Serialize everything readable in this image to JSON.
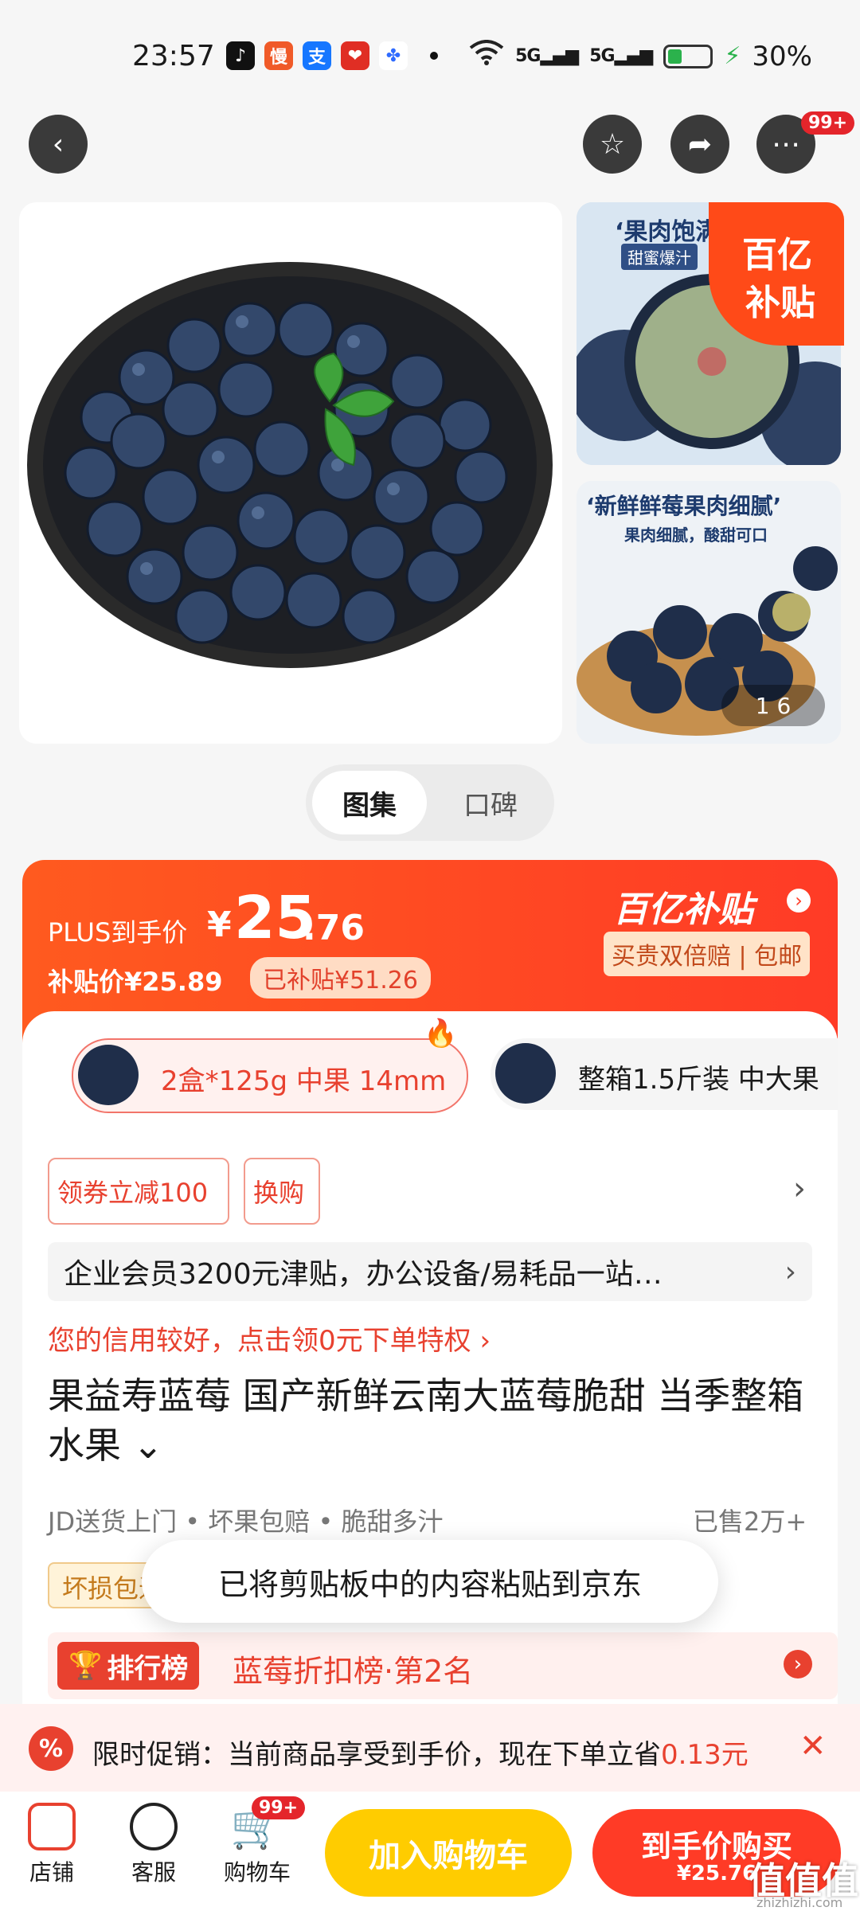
{
  "status_bar": {
    "time": "23:57",
    "battery": "30%",
    "apps": [
      {
        "icon": "douyin-icon",
        "glyph": "♪",
        "color": "#111111"
      },
      {
        "icon": "mantou-icon",
        "glyph": "慢",
        "color": "#f05a28"
      },
      {
        "icon": "alipay-icon",
        "glyph": "支",
        "color": "#1677ff"
      },
      {
        "icon": "pinduoduo-icon",
        "glyph": "❤",
        "color": "#e02e24"
      },
      {
        "icon": "baidu-icon",
        "glyph": "🐾",
        "color": "#ffffff"
      }
    ],
    "signal_1": "5G",
    "signal_2": "5G"
  },
  "nav": {
    "more_badge": "99+"
  },
  "gallery": {
    "thumb1_caption": "‘果肉饱满",
    "thumb1_sub": "甜蜜爆汁",
    "thumb2_caption": "‘新鲜鲜莓果肉细腻’",
    "thumb2_sub": "果肉细腻，酸甜可口",
    "subsidy_badge_top": "百亿",
    "subsidy_badge_bottom": "补贴",
    "page_indicator": "1   6"
  },
  "tabs": {
    "active": "图集",
    "inactive": "口碑"
  },
  "price": {
    "plus_label": "PLUS到手价",
    "currency": "¥",
    "main_int": "25",
    "main_dec": ".76",
    "subsidy_price": "补贴价¥25.89",
    "already_subsidized": "已补贴¥51.26",
    "brand": "百亿补贴",
    "brand_tags": "买贵双倍赔 | 包邮"
  },
  "specs": [
    {
      "label": "2盒*125g 中果 14mm",
      "selected": true
    },
    {
      "label": "整箱1.5斤装 中大果",
      "selected": false
    }
  ],
  "coupons": {
    "coupon": "领券立减100",
    "exchange": "换购"
  },
  "enterprise": "企业会员3200元津贴，办公设备/易耗品一站…",
  "credit": "您的信用较好，点击领0元下单特权 ›",
  "title": "果益寿蓝莓 国产新鲜云南大蓝莓脆甜 当季整箱水果 ⌄",
  "services": "JD送货上门 • 坏果包赔 • 脆甜多汁",
  "sold": "已售2万+",
  "damage_tag": "坏损包退",
  "toast": "已将剪贴板中的内容粘贴到京东",
  "rank": {
    "label": "排行榜",
    "text": "蓝莓折扣榜·第2名"
  },
  "promo": {
    "text_prefix": "限时促销：当前商品享受到手价，现在下单立省",
    "amount": "0.13元"
  },
  "bottom_bar": {
    "store": "店铺",
    "service": "客服",
    "cart": "购物车",
    "cart_badge": "99+",
    "add_cart": "加入购物车",
    "buy_now": "到手价购买",
    "buy_price": "¥25.76",
    "watermark": "值值值",
    "watermark_sub": "zhizhizhi.com"
  },
  "colors": {
    "accent": "#ff3b26",
    "add_cart_bg": "#ffcc00",
    "buy_bg": "#ff3b26"
  }
}
